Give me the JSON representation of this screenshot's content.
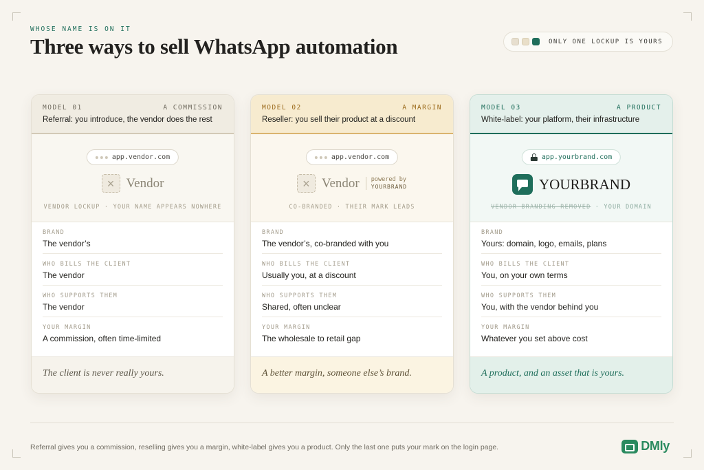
{
  "header": {
    "eyebrow": "WHOSE NAME IS ON IT",
    "title": "Three ways to sell WhatsApp automation",
    "legend_text": "ONLY ONE LOCKUP IS YOURS"
  },
  "cards": [
    {
      "model": "MODEL 01",
      "kind": "A COMMISSION",
      "subtitle": "Referral: you introduce, the vendor does the rest",
      "url": "app.vendor.com",
      "vendor_name": "Vendor",
      "caption": "VENDOR LOCKUP · YOUR NAME APPEARS NOWHERE",
      "rows": [
        {
          "label": "BRAND",
          "value": "The vendor’s"
        },
        {
          "label": "WHO BILLS THE CLIENT",
          "value": "The vendor"
        },
        {
          "label": "WHO SUPPORTS THEM",
          "value": "The vendor"
        },
        {
          "label": "YOUR MARGIN",
          "value": "A commission, often time-limited"
        }
      ],
      "footer": "The client is never really yours."
    },
    {
      "model": "MODEL 02",
      "kind": "A MARGIN",
      "subtitle": "Reseller: you sell their product at a discount",
      "url": "app.vendor.com",
      "vendor_name": "Vendor",
      "powered_by": "powered by",
      "powered_brand": "YOURBRAND",
      "caption": "CO-BRANDED · THEIR MARK LEADS",
      "rows": [
        {
          "label": "BRAND",
          "value": "The vendor’s, co-branded with you"
        },
        {
          "label": "WHO BILLS THE CLIENT",
          "value": "Usually you, at a discount"
        },
        {
          "label": "WHO SUPPORTS THEM",
          "value": "Shared, often unclear"
        },
        {
          "label": "YOUR MARGIN",
          "value": "The wholesale to retail gap"
        }
      ],
      "footer": "A better margin, someone else’s brand."
    },
    {
      "model": "MODEL 03",
      "kind": "A PRODUCT",
      "subtitle": "White-label: your platform, their infrastructure",
      "url": "app.yourbrand.com",
      "brand_name": "YOURBRAND",
      "caption_struck": "VENDOR BRANDING REMOVED",
      "caption_rest": " · YOUR DOMAIN",
      "rows": [
        {
          "label": "BRAND",
          "value": "Yours: domain, logo, emails, plans"
        },
        {
          "label": "WHO BILLS THE CLIENT",
          "value": "You, on your own terms"
        },
        {
          "label": "WHO SUPPORTS THEM",
          "value": "You, with the vendor behind you"
        },
        {
          "label": "YOUR MARGIN",
          "value": "Whatever you set above cost"
        }
      ],
      "footer": "A product, and an asset that is yours."
    }
  ],
  "footer": {
    "note": "Referral gives you a commission, reselling gives you a margin, white-label gives you a product. Only the last one puts your mark on the login page.",
    "logo_text": "DMly"
  },
  "colors": {
    "accent": "#1f6e5b",
    "reseller_accent": "#dab46e",
    "logo_green": "#2a8a5f",
    "background": "#f7f4ee"
  }
}
